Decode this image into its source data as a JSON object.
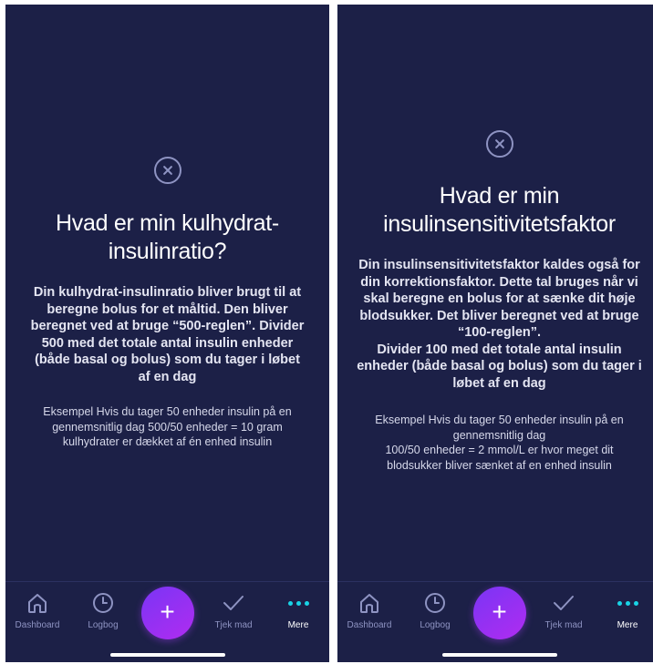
{
  "left": {
    "title": "Hvad er min kulhydrat-insulinratio?",
    "body": "Din kulhydrat-insulinratio bliver brugt til at beregne bolus for et måltid. Den bliver beregnet ved at bruge “500-reglen”. Divider 500 med det totale antal insulin enheder (både basal og bolus) som du tager i løbet af en dag",
    "example": "Eksempel Hvis du tager 50 enheder insulin på en gennemsnitlig dag 500/50 enheder = 10 gram kulhydrater er dækket af én enhed insulin"
  },
  "right": {
    "title": "Hvad er min insulinsensitivitetsfaktor",
    "body": "Din insulinsensitivitetsfaktor kaldes også for din korrektionsfaktor. Dette tal bruges når vi skal beregne en bolus for at sænke dit høje blodsukker. Det bliver beregnet ved at bruge “100-reglen”.\nDivider 100 med det totale antal insulin enheder (både basal og bolus) som du tager i løbet af en dag",
    "example": "Eksempel Hvis du tager 50 enheder insulin på en gennemsnitlig dag\n100/50 enheder = 2 mmol/L er hvor meget dit blodsukker bliver sænket af en enhed insulin"
  },
  "nav": {
    "dashboard": "Dashboard",
    "logbog": "Logbog",
    "add": "+",
    "tjek_mad": "Tjek mad",
    "mere": "Mere"
  },
  "colors": {
    "background": "#1c2047",
    "accent": "#19d3e6",
    "add_gradient_start": "#7a35f5",
    "add_gradient_end": "#b02cf0"
  },
  "icons": [
    "close-icon",
    "home-icon",
    "clock-icon",
    "plus-icon",
    "checkmark-icon",
    "more-dots-icon"
  ]
}
